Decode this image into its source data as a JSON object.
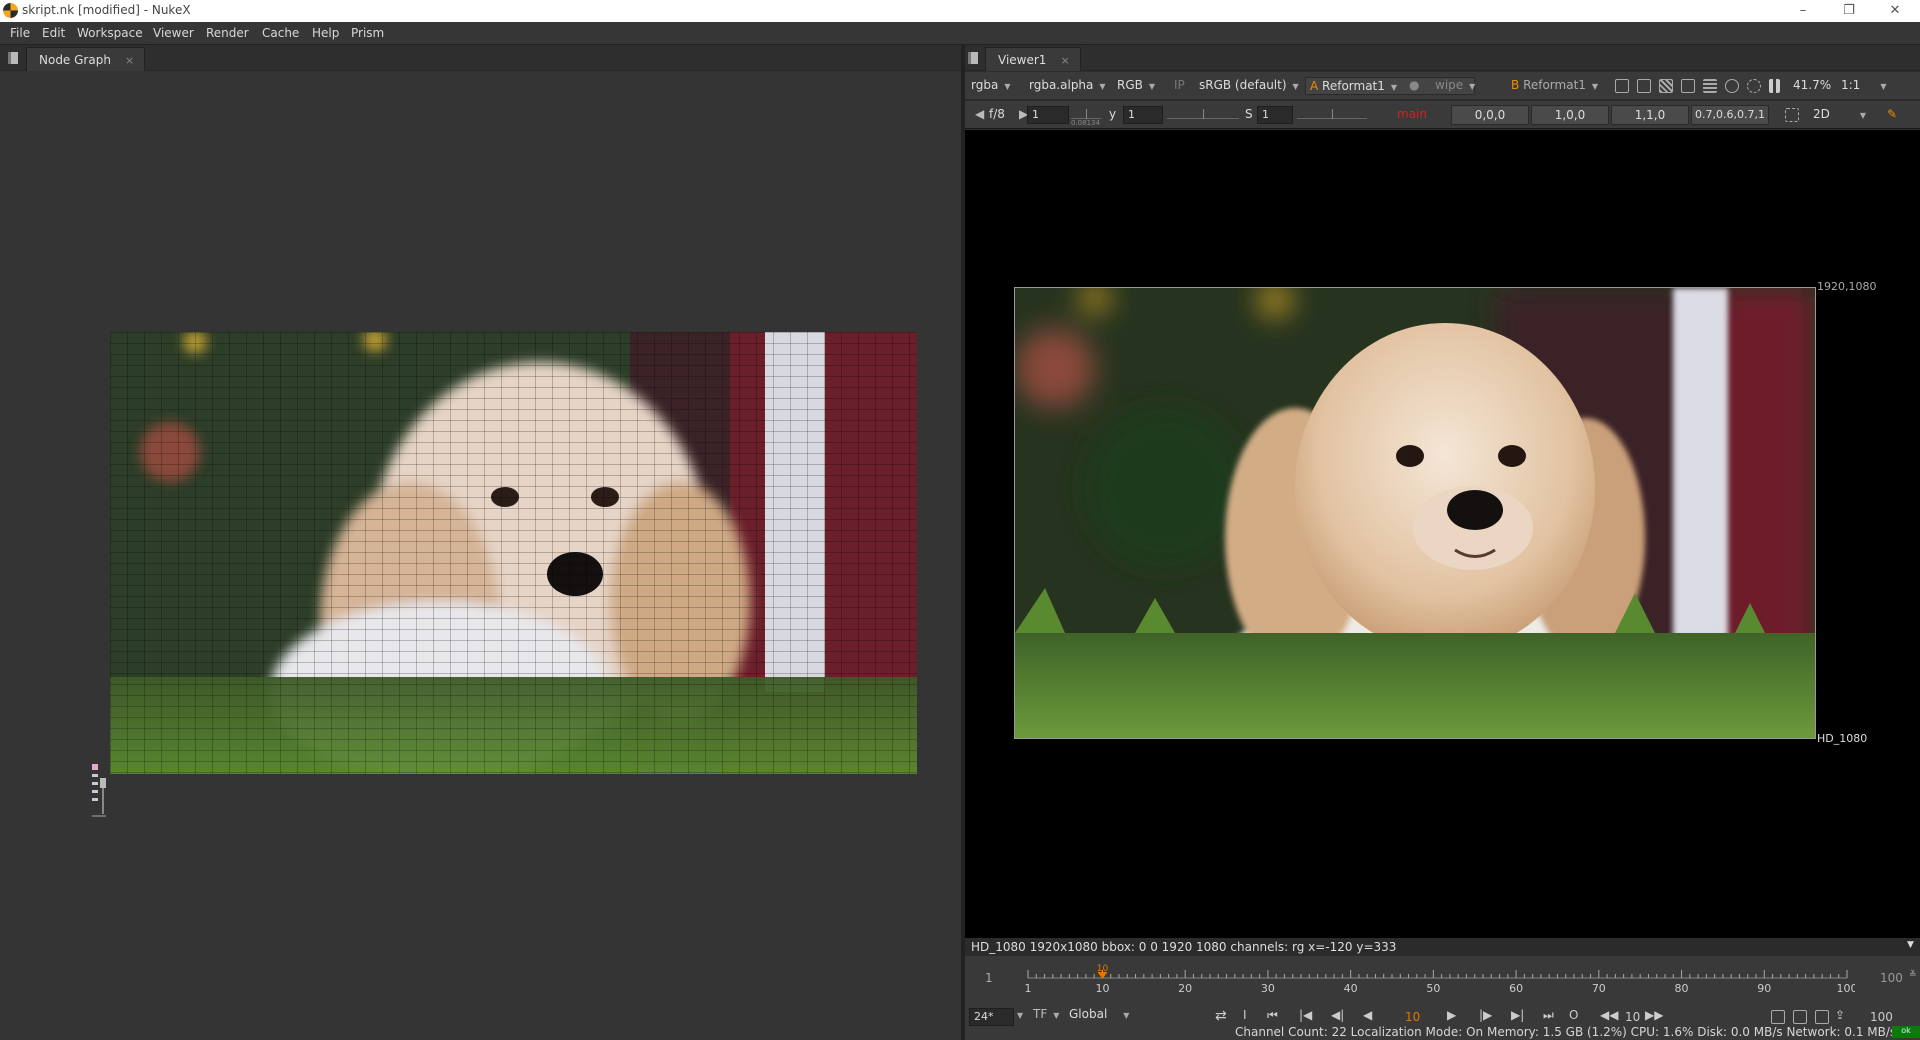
{
  "window": {
    "title": "skript.nk [modified] - NukeX",
    "controls": [
      "–",
      "❐",
      "✕"
    ]
  },
  "menu": [
    "File",
    "Edit",
    "Workspace",
    "Viewer",
    "Render",
    "Cache",
    "Help",
    "Prism"
  ],
  "node_graph": {
    "tab": "Node Graph",
    "close": "×"
  },
  "viewer": {
    "tab": "Viewer1",
    "close": "×",
    "toolbar1": {
      "channels": "rgba",
      "alpha": "rgba.alpha",
      "display": "RGB",
      "ip": "IP",
      "lut": "sRGB (default)",
      "a_label": "A",
      "a_input": "Reformat1",
      "wipe": "wipe",
      "b_label": "B",
      "b_input": "Reformat1",
      "zoom": "41.7%",
      "ratio": "1:1"
    },
    "toolbar2": {
      "fstop": "f/8",
      "gain": "1",
      "gain_sub": "0.08134",
      "gamma_label": "y",
      "gamma": "1",
      "sat_label": "S",
      "sat": "1",
      "view": "main",
      "v1": "0,0,0",
      "v2": "1,0,0",
      "v3": "1,1,0",
      "v4": "0.7,0.6,0.7,1",
      "mode": "2D"
    },
    "format_tr": "1920,1080",
    "format_br": "HD_1080",
    "info": "HD_1080 1920x1080  bbox: 0 0 1920 1080 channels: rg  x=-120 y=333"
  },
  "timeline": {
    "start": "1",
    "end": "100",
    "current": "10",
    "fps": "24*",
    "tf": "TF",
    "scope": "Global",
    "frame_field": "10",
    "step": "10",
    "end2": "100",
    "ticks": [
      "1",
      "10",
      "20",
      "30",
      "40",
      "50",
      "60",
      "70",
      "80",
      "90",
      "100"
    ]
  },
  "status": {
    "text": "Channel Count: 22  Localization Mode: On  Memory: 1.5 GB (1.2%)  CPU: 1.6%  Disk: 0.0 MB/s  Network: 0.1 MB/s",
    "indicator": "ok"
  },
  "colors": {
    "accent": "#f08c00",
    "view_red": "#d42020",
    "frame_orange": "#e07800"
  }
}
